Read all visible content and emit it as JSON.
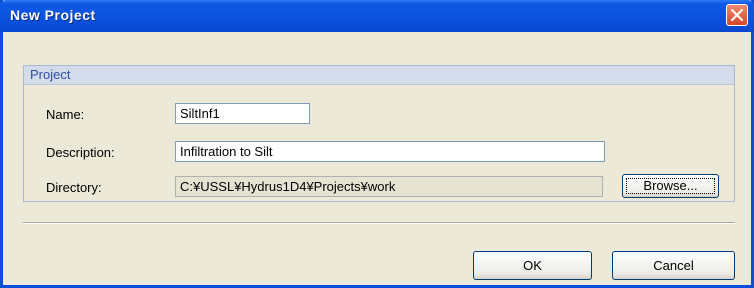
{
  "dialog": {
    "title": "New Project",
    "close_icon": "close-icon"
  },
  "group": {
    "title": "Project"
  },
  "fields": {
    "name_label": "Name:",
    "name_value": "SiltInf1",
    "description_label": "Description:",
    "description_value": "Infiltration to Silt",
    "directory_label": "Directory:",
    "directory_value": "C:¥USSL¥Hydrus1D4¥Projects¥work"
  },
  "buttons": {
    "browse_label": "Browse...",
    "ok_label": "OK",
    "cancel_label": "Cancel"
  },
  "colors": {
    "title_bar": "#0b52df",
    "close_button": "#d9452a",
    "group_title": "#2b4fa2"
  }
}
